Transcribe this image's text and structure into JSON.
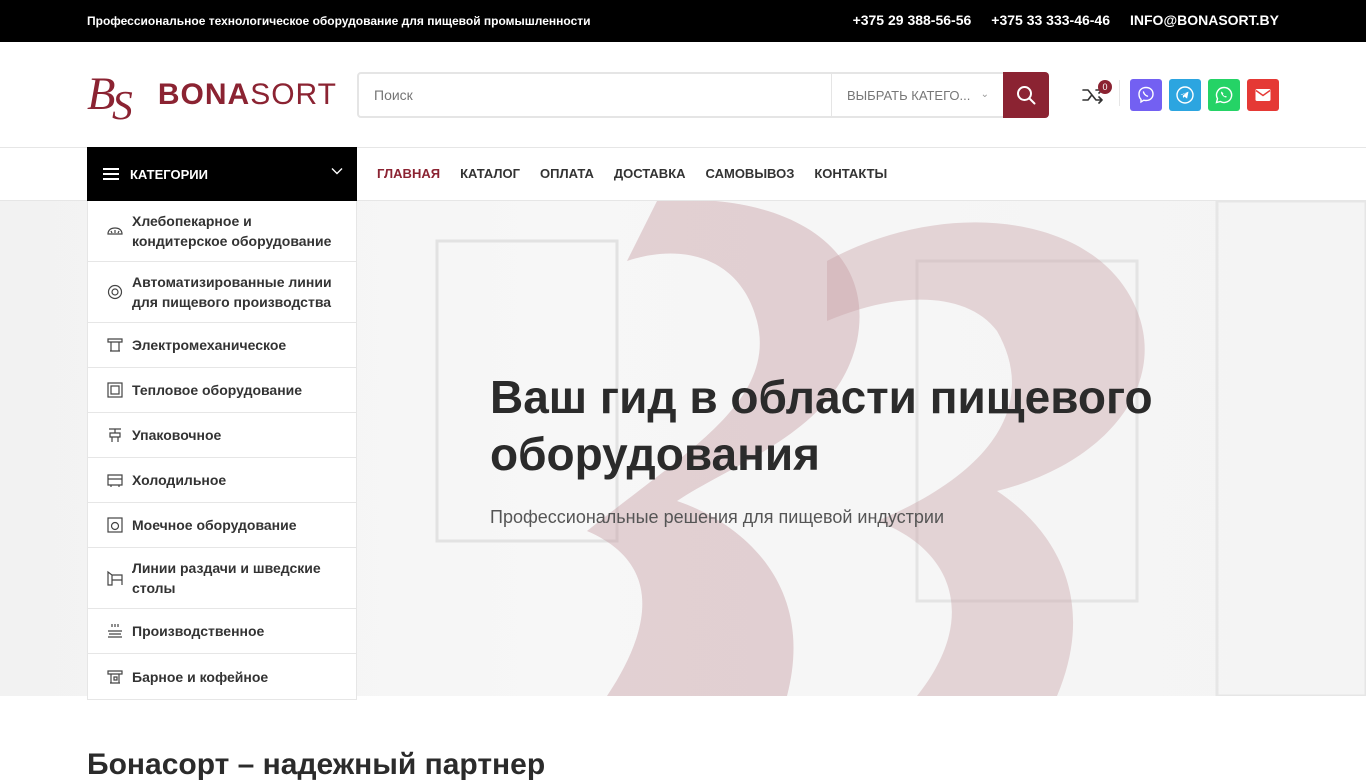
{
  "topbar": {
    "tagline": "Профессиональное технологическое оборудование для пищевой промышленности",
    "phone1": "+375 29 388-56-56",
    "phone2": "+375 33 333-46-46",
    "email": "INFO@BONASORT.BY"
  },
  "header": {
    "logo_text_bold": "BONA",
    "logo_text_light": "SORT",
    "search_placeholder": "Поиск",
    "category_select": "ВЫБРАТЬ КАТЕГО...",
    "compare_count": "0"
  },
  "social": [
    {
      "name": "viber",
      "color": "#7360f2"
    },
    {
      "name": "telegram",
      "color": "#2ca5e0"
    },
    {
      "name": "whatsapp",
      "color": "#25d366"
    },
    {
      "name": "email",
      "color": "#e53935"
    }
  ],
  "nav": {
    "categories_label": "КАТЕГОРИИ",
    "items": [
      "ГЛАВНАЯ",
      "КАТАЛОГ",
      "ОПЛАТА",
      "ДОСТАВКА",
      "САМОВЫВОЗ",
      "КОНТАКТЫ"
    ]
  },
  "categories": [
    "Хлебопекарное и кондитерское оборудование",
    "Автоматизированные линии для пищевого производства",
    "Электромеханическое",
    "Тепловое оборудование",
    "Упаковочное",
    "Холодильное",
    "Моечное оборудование",
    "Линии раздачи и шведские столы",
    "Производственное",
    "Барное и кофейное"
  ],
  "hero": {
    "title": "Ваш гид в области пищевого оборудования",
    "subtitle": "Профессиональные решения для пищевой индустрии"
  },
  "section": {
    "title": "Бонасорт – надежный партнер"
  },
  "colors": {
    "brand": "#8b2332",
    "topbar": "#000000"
  }
}
